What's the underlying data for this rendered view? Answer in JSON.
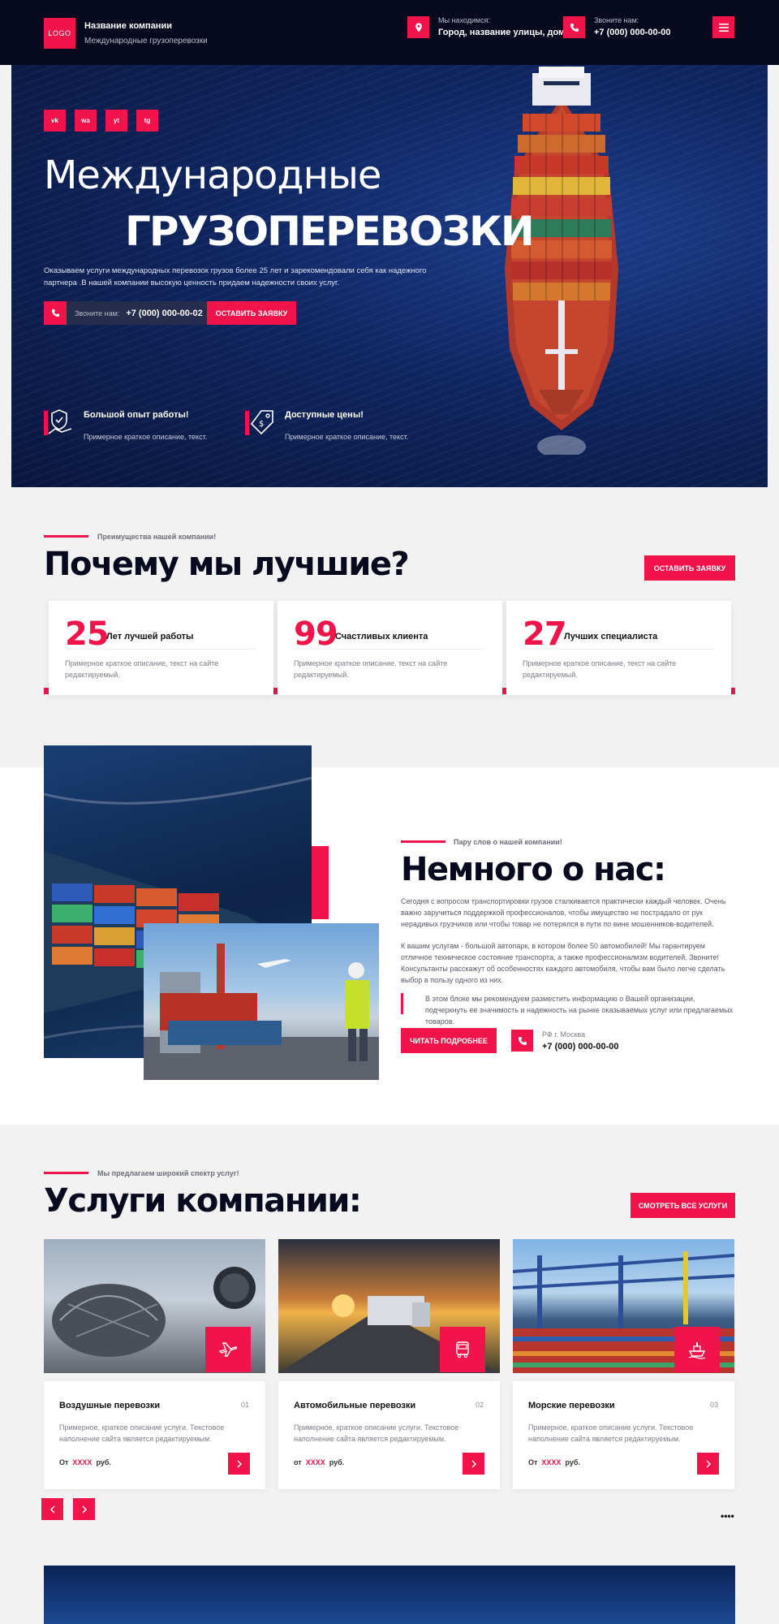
{
  "header": {
    "logo": "LOGO",
    "company_name": "Название компании",
    "company_sub": "Международные грузоперевозки",
    "location_label": "Мы находимся:",
    "location_value": "Город, название улицы, дом",
    "phone_label": "Звоните нам:",
    "phone_value": "+7 (000) 000-00-00"
  },
  "hero": {
    "socials": [
      "vk",
      "wa",
      "yt",
      "tg"
    ],
    "title_line1": "Международные",
    "title_line2": "ГРУЗОПЕРЕВОЗКИ",
    "description": "Оказываем услуги международных перевозок грузов более 25 лет и зарекомендовали себя как надежного партнера .В нашей компании высокую ценность придаем надежности своих услуг.",
    "call_label": "Звоните нам:",
    "call_number": "+7 (000) 000-00-02",
    "cta": "ОСТАВИТЬ ЗАЯВКУ",
    "features": [
      {
        "title": "Большой опыт работы!",
        "desc": "Примерное краткое описание, текст."
      },
      {
        "title": "Доступные цены!",
        "desc": "Примерное краткое описание, текст."
      }
    ]
  },
  "why": {
    "subtitle": "Преимущества нашей компании!",
    "title": "Почему мы лучшие?",
    "cta": "ОСТАВИТЬ ЗАЯВКУ",
    "stats": [
      {
        "number": "25",
        "label": "Лет лучшей работы",
        "desc": "Примерное краткое описание, текст на сайте редактируемый."
      },
      {
        "number": "99",
        "label": "Счастливых клиента",
        "desc": "Примерное краткое описание, текст на сайте редактируемый."
      },
      {
        "number": "27",
        "label": "Лучших специалиста",
        "desc": "Примерное краткое описание, текст на сайте редактируемый."
      }
    ]
  },
  "about": {
    "subtitle": "Пару слов о нашей компании!",
    "title": "Немного о нас:",
    "p1": "Сегодня с вопросом транспортировки грузов сталкивается практически каждый человек. Очень важно заручиться поддержкой профессионалов, чтобы имущество не пострадало от рук нерадивых грузчиков или чтобы товар не потерялся в пути по вине мошенников-водителей.",
    "p2": "К вашим услугам - большой автопарк, в котором более 50 автомобилей! Мы гарантируем отличное техническое состояние транспорта, а также профессионализм водителей. Звоните! Консультанты расскажут об особенностях каждого автомобиля, чтобы вам было легче сделать выбор в пользу одного из них.",
    "quote": "В этом блоке мы рекомендуем разместить информацию о Вашей организации, подчеркнуть ее значимость и надежность на рынке оказываемых услуг или предлагаемых товаров.",
    "cta": "ЧИТАТЬ ПОДРОБНЕЕ",
    "city": "РФ г. Москва",
    "phone": "+7 (000) 000-00-00"
  },
  "services": {
    "subtitle": "Мы предлагаем широкий спектр услуг!",
    "title": "Услуги компании:",
    "cta": "СМОТРЕТЬ ВСЕ УСЛУГИ",
    "items": [
      {
        "title": "Воздушные перевозки",
        "num": "01",
        "desc": "Примерное, краткое описание услуги. Текстовое наполнение сайта является редактируемым.",
        "price_from": "От",
        "price": "XXXX",
        "currency": "руб.",
        "icon": "plane-icon"
      },
      {
        "title": "Автомобильные перевозки",
        "num": "02",
        "desc": "Примерное, краткое описание услуги. Текстовое наполнение сайта является редактируемым.",
        "price_from": "от",
        "price": "XXXX",
        "currency": "руб.",
        "icon": "truck-icon"
      },
      {
        "title": "Морские перевозки",
        "num": "03",
        "desc": "Примерное, краткое описание услуги. Текстовое наполнение сайта является редактируемым.",
        "price_from": "От",
        "price": "XXXX",
        "currency": "руб.",
        "icon": "ship-icon"
      }
    ],
    "more": "••••"
  },
  "colors": {
    "accent": "#f0144a",
    "dark": "#070a1e"
  }
}
